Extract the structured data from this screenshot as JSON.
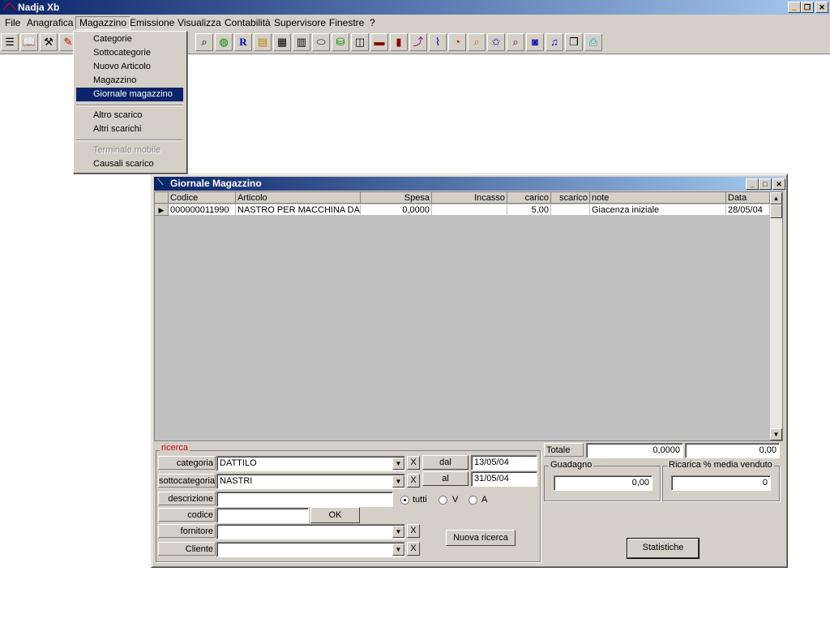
{
  "app": {
    "title": "Nadja Xb"
  },
  "menubar": {
    "items": [
      {
        "label": "File"
      },
      {
        "label": "Anagrafica"
      },
      {
        "label": "Magazzino"
      },
      {
        "label": "Emissione"
      },
      {
        "label": "Visualizza"
      },
      {
        "label": "Contabilità"
      },
      {
        "label": "Supervisore"
      },
      {
        "label": "Finestre"
      },
      {
        "label": "?"
      }
    ]
  },
  "toolbar": {
    "icons": [
      "list-icon",
      "book-icon",
      "hammer-icon",
      "pencil-icon",
      "search-icon",
      "globe-icon",
      "r-icon",
      "folder-icon",
      "box-icon",
      "film-icon",
      "eraser-icon",
      "basket-icon",
      "stack-icon",
      "chart-icon",
      "bars-icon",
      "trend-icon",
      "graph-icon",
      "pie-icon",
      "magnifier-icon",
      "star-icon",
      "zoom-icon",
      "zoom2-icon",
      "music-icon",
      "folders-icon",
      "printer-icon"
    ]
  },
  "magazzino_menu": {
    "items": [
      {
        "label": "Categorie"
      },
      {
        "label": "Sottocategorie"
      },
      {
        "label": "Nuovo Articolo"
      },
      {
        "label": "Magazzino"
      },
      {
        "label": "Giornale magazzino"
      },
      {
        "label": "Altro scarico"
      },
      {
        "label": "Altri scarichi"
      },
      {
        "label": "Terminale mobile"
      },
      {
        "label": "Causali scarico"
      }
    ]
  },
  "window": {
    "title": "Giornale Magazzino",
    "grid": {
      "headers": [
        "Codice",
        "Articolo",
        "Spesa",
        "Incasso",
        "carico",
        "scarico",
        "note",
        "Data"
      ],
      "rows": [
        [
          "000000011990",
          "NASTRO PER MACCHINA DA",
          "0,0000",
          "",
          "5,00",
          "",
          "Giacenza iniziale",
          "28/05/04"
        ]
      ]
    },
    "search": {
      "legend": "ricerca",
      "categoria_label": "categoria",
      "categoria_value": "DATTILO",
      "sottocategoria_label": "sottocategoria",
      "sottocategoria_value": "NASTRI",
      "descrizione_label": "descrizione",
      "descrizione_value": "",
      "codice_label": "codice",
      "codice_value": "",
      "fornitore_label": "fornitore",
      "fornitore_value": "",
      "cliente_label": "Cliente",
      "cliente_value": "",
      "dal_label": "dal",
      "dal_value": "13/05/04",
      "al_label": "al",
      "al_value": "31/05/04",
      "radio_tutti": "tutti",
      "radio_v": "V",
      "radio_a": "A",
      "ok_label": "OK",
      "nuova_ricerca_label": "Nuova ricerca",
      "clear_label": "X"
    },
    "totals": {
      "totale_label": "Totale",
      "totale_spesa": "0,0000",
      "totale_carico": "0,00",
      "guadagno_label": "Guadagno",
      "guadagno_value": "0,00",
      "ricarica_label": "Ricarica % media venduto",
      "ricarica_value": "0",
      "statistiche_label": "Statistiche"
    }
  }
}
